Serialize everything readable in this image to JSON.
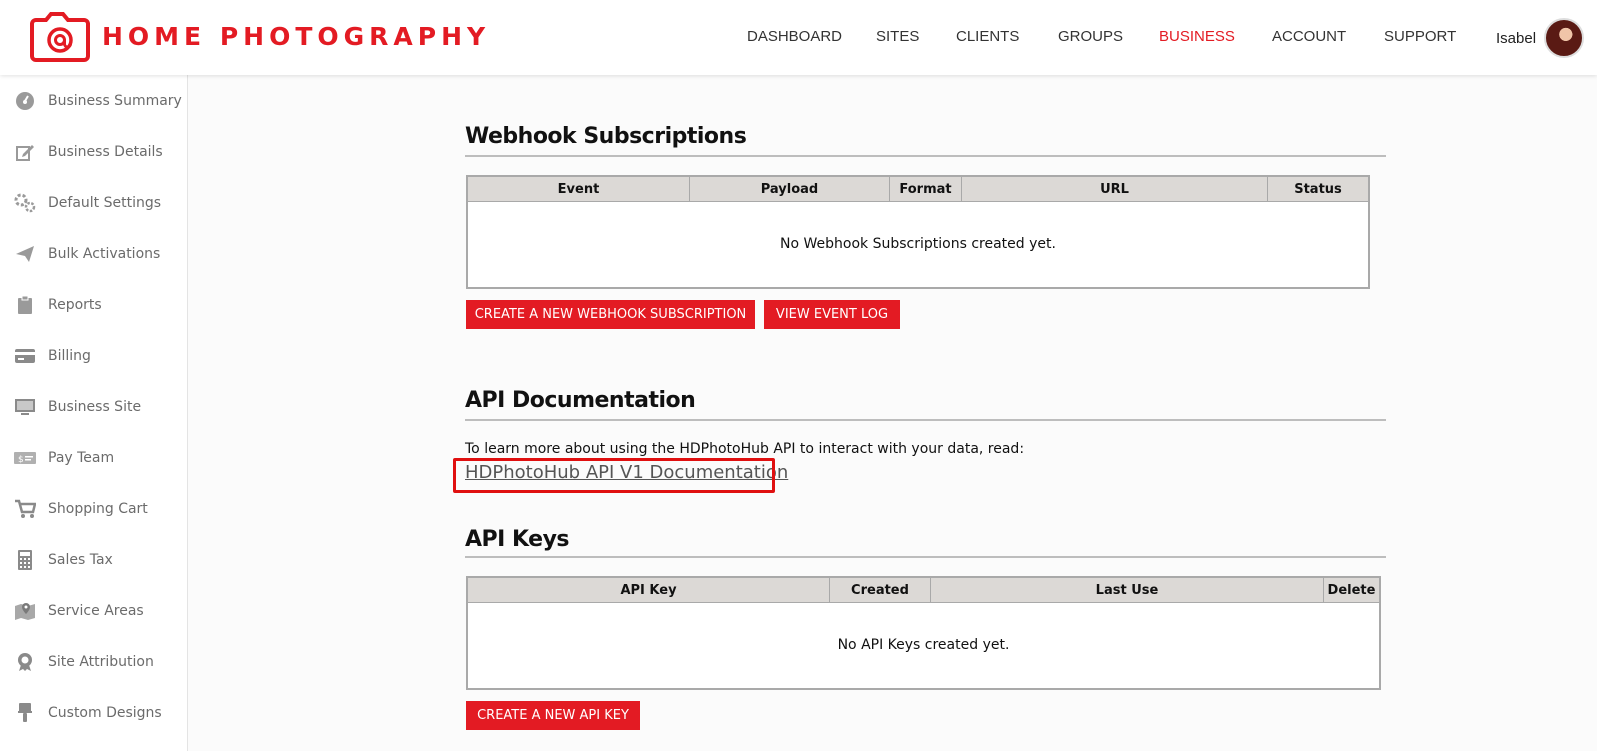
{
  "brand": {
    "name": "HOME PHOTOGRAPHY",
    "color": "#e31b23"
  },
  "nav": [
    {
      "label": "DASHBOARD",
      "active": false
    },
    {
      "label": "SITES",
      "active": false
    },
    {
      "label": "CLIENTS",
      "active": false
    },
    {
      "label": "GROUPS",
      "active": false
    },
    {
      "label": "BUSINESS",
      "active": true
    },
    {
      "label": "ACCOUNT",
      "active": false
    },
    {
      "label": "SUPPORT",
      "active": false
    }
  ],
  "user": {
    "name": "Isabel"
  },
  "sidebar": {
    "items": [
      {
        "label": "Business Summary",
        "icon": "gauge-icon"
      },
      {
        "label": "Business Details",
        "icon": "edit-icon"
      },
      {
        "label": "Default Settings",
        "icon": "gears-icon"
      },
      {
        "label": "Bulk Activations",
        "icon": "paper-plane-icon"
      },
      {
        "label": "Reports",
        "icon": "clipboard-icon"
      },
      {
        "label": "Billing",
        "icon": "credit-card-icon"
      },
      {
        "label": "Business Site",
        "icon": "monitor-icon"
      },
      {
        "label": "Pay Team",
        "icon": "money-icon"
      },
      {
        "label": "Shopping Cart",
        "icon": "cart-icon"
      },
      {
        "label": "Sales Tax",
        "icon": "calculator-icon"
      },
      {
        "label": "Service Areas",
        "icon": "map-icon"
      },
      {
        "label": "Site Attribution",
        "icon": "award-icon"
      },
      {
        "label": "Custom Designs",
        "icon": "paint-brush-icon"
      }
    ]
  },
  "webhooks": {
    "title": "Webhook Subscriptions",
    "columns": [
      "Event",
      "Payload",
      "Format",
      "URL",
      "Status"
    ],
    "empty": "No Webhook Subscriptions created yet.",
    "create_label": "CREATE A NEW WEBHOOK SUBSCRIPTION",
    "log_label": "VIEW EVENT LOG"
  },
  "api_docs": {
    "title": "API Documentation",
    "text": "To learn more about using the HDPhotoHub API to interact with your data, read:",
    "link": "HDPhotoHub API V1 Documentation"
  },
  "api_keys": {
    "title": "API Keys",
    "columns": [
      "API Key",
      "Created",
      "Last Use",
      "Delete"
    ],
    "empty": "No API Keys created yet.",
    "create_label": "CREATE A NEW API KEY"
  }
}
